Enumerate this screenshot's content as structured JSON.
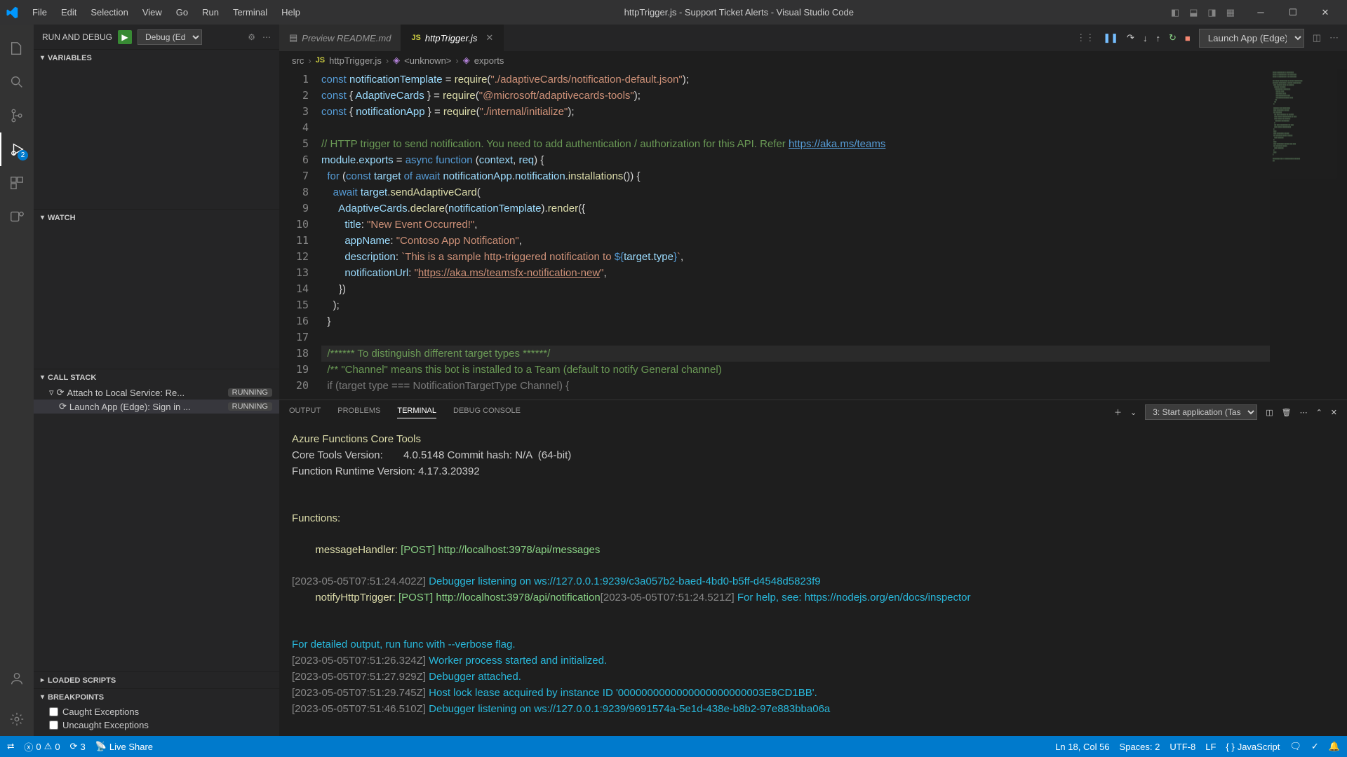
{
  "window": {
    "title": "httpTrigger.js - Support Ticket Alerts - Visual Studio Code"
  },
  "menu": [
    "File",
    "Edit",
    "Selection",
    "View",
    "Go",
    "Run",
    "Terminal",
    "Help"
  ],
  "activity": {
    "debug_badge": "2"
  },
  "runDebug": {
    "header": "RUN AND DEBUG",
    "config": "Debug (Ed",
    "sections": {
      "variables": "VARIABLES",
      "watch": "WATCH",
      "callstack": "CALL STACK",
      "loaded": "LOADED SCRIPTS",
      "breakpoints": "BREAKPOINTS"
    },
    "callstack_items": [
      {
        "label": "Attach to Local Service: Re...",
        "state": "RUNNING",
        "sel": false
      },
      {
        "label": "Launch App (Edge): Sign in ...",
        "state": "RUNNING",
        "sel": true
      }
    ],
    "breakpoints_items": [
      "Caught Exceptions",
      "Uncaught Exceptions"
    ]
  },
  "tabs": [
    {
      "label": "Preview README.md",
      "active": false,
      "icon": "preview"
    },
    {
      "label": "httpTrigger.js",
      "active": true,
      "icon": "js"
    }
  ],
  "debugToolbar": {
    "launch": "Launch App (Edge)"
  },
  "breadcrumb": {
    "folder": "src",
    "file": "httpTrigger.js",
    "sym1": "<unknown>",
    "sym2": "exports"
  },
  "code": {
    "lines": [
      1,
      2,
      3,
      4,
      5,
      6,
      7,
      8,
      9,
      10,
      11,
      12,
      13,
      14,
      15,
      16,
      17,
      18,
      19,
      20
    ],
    "l1a": "const ",
    "l1b": "notificationTemplate",
    "l1c": " = ",
    "l1d": "require",
    "l1e": "(",
    "l1f": "\"./adaptiveCards/notification-default.json\"",
    "l1g": ");",
    "l2a": "const ",
    "l2b": "{ ",
    "l2c": "AdaptiveCards",
    "l2d": " } = ",
    "l2e": "require",
    "l2f": "(",
    "l2g": "\"@microsoft/adaptivecards-tools\"",
    "l2h": ");",
    "l3a": "const ",
    "l3b": "{ ",
    "l3c": "notificationApp",
    "l3d": " } = ",
    "l3e": "require",
    "l3f": "(",
    "l3g": "\"./internal/initialize\"",
    "l3h": ");",
    "l5": "// HTTP trigger to send notification. You need to add authentication / authorization for this API. Refer ",
    "l5link": "https://aka.ms/teams",
    "l6a": "module",
    "l6b": ".",
    "l6c": "exports",
    "l6d": " = ",
    "l6e": "async function ",
    "l6f": "(",
    "l6g": "context",
    "l6h": ", ",
    "l6i": "req",
    "l6j": ") {",
    "l7a": "  for ",
    "l7b": "(",
    "l7c": "const ",
    "l7d": "target",
    "l7e": " of ",
    "l7f": "await ",
    "l7g": "notificationApp",
    "l7h": ".",
    "l7i": "notification",
    "l7j": ".",
    "l7k": "installations",
    "l7l": "()) {",
    "l8a": "    await ",
    "l8b": "target",
    "l8c": ".",
    "l8d": "sendAdaptiveCard",
    "l8e": "(",
    "l9a": "      AdaptiveCards",
    "l9b": ".",
    "l9c": "declare",
    "l9d": "(",
    "l9e": "notificationTemplate",
    "l9f": ").",
    "l9g": "render",
    "l9h": "({",
    "l10a": "        title",
    "l10b": ": ",
    "l10c": "\"New Event Occurred!\"",
    "l10d": ",",
    "l11a": "        appName",
    "l11b": ": ",
    "l11c": "\"Contoso App Notification\"",
    "l11d": ",",
    "l12a": "        description",
    "l12b": ": ",
    "l12c": "`This is a sample http-triggered notification to ",
    "l12d": "${",
    "l12e": "target",
    "l12f": ".",
    "l12g": "type",
    "l12h": "}",
    "l12i": "`",
    "l12j": ",",
    "l13a": "        notificationUrl",
    "l13b": ": ",
    "l13c": "\"",
    "l13d": "https://aka.ms/teamsfx-notification-new",
    "l13e": "\"",
    "l13f": ",",
    "l14": "      })",
    "l15": "    );",
    "l16": "  }",
    "l18": "  /****** To distinguish different target types ******/",
    "l19": "  /** \"Channel\" means this bot is installed to a Team (default to notify General channel)",
    "l20": "  if (target type === NotificationTargetType Channel) {"
  },
  "panel": {
    "tabs": [
      "OUTPUT",
      "PROBLEMS",
      "TERMINAL",
      "DEBUG CONSOLE"
    ],
    "active": "TERMINAL",
    "select": "3: Start application (Tasl",
    "t1": "Azure Functions Core Tools",
    "t2": "Core Tools Version:       4.0.5148 Commit hash: N/A  (64-bit)",
    "t3": "Function Runtime Version: 4.17.3.20392",
    "t4": "Functions:",
    "t5a": "        messageHandler:",
    "t5b": " [POST] http://localhost:3978/api/messages",
    "t6a": "[2023-05-05T07:51:24.402Z] ",
    "t6b": "Debugger listening on ws://127.0.0.1:9239/c3a057b2-baed-4bd0-b5ff-d4548d5823f9",
    "t6c": "        notifyHttpTrigger:",
    "t6d": " [POST] http://localhost:3978/api/notification",
    "t6e": "[2023-05-05T07:51:24.521Z] ",
    "t6f": "For help, see: https://nodejs.org/en/docs/inspector",
    "t7": "For detailed output, run func with --verbose flag.",
    "t8a": "[2023-05-05T07:51:26.324Z] ",
    "t8b": "Worker process started and initialized.",
    "t9a": "[2023-05-05T07:51:27.929Z] ",
    "t9b": "Debugger attached.",
    "t10a": "[2023-05-05T07:51:29.745Z] ",
    "t10b": "Host lock lease acquired by instance ID '0000000000000000000000003E8CD1BB'.",
    "t11a": "[2023-05-05T07:51:46.510Z] ",
    "t11b": "Debugger listening on ws://127.0.0.1:9239/9691574a-5e1d-438e-b8b2-97e883bba06a"
  },
  "status": {
    "remote": "",
    "errors": "0",
    "warnings": "0",
    "ports": "3",
    "liveshare": "Live Share",
    "pos": "Ln 18, Col 56",
    "spaces": "Spaces: 2",
    "enc": "UTF-8",
    "eol": "LF",
    "lang": "JavaScript"
  }
}
